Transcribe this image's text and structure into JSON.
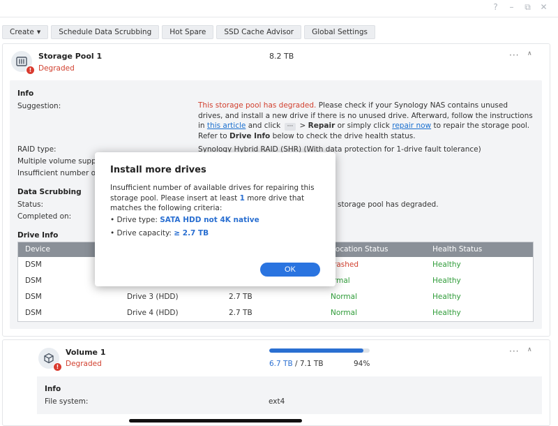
{
  "window_controls": {
    "help": "?",
    "minimize": "–",
    "restore": "⧉",
    "close": "✕"
  },
  "toolbar": {
    "create_label": "Create",
    "scrub_label": "Schedule Data Scrubbing",
    "hotspare_label": "Hot Spare",
    "ssd_label": "SSD Cache Advisor",
    "global_label": "Global Settings"
  },
  "pool": {
    "name": "Storage Pool 1",
    "status": "Degraded",
    "size": "8.2 TB",
    "info": {
      "title": "Info",
      "suggestion_label": "Suggestion:",
      "sugg_red": "This storage pool has degraded.",
      "sugg_1": " Please check if your Synology NAS contains unused drives, and install a new drive if there is no unused drive. Afterward, follow the instructions in ",
      "sugg_link1": "this article",
      "sugg_2": " and click ",
      "sugg_dots": "···",
      "sugg_3": " > ",
      "sugg_repair": "Repair",
      "sugg_4": " or simply click ",
      "sugg_link2": "repair now",
      "sugg_5": " to repair the storage pool. Refer to ",
      "sugg_driveinfo": "Drive Info",
      "sugg_6": " below to check the drive health status.",
      "raid_label": "RAID type:",
      "raid_value": "Synology Hybrid RAID (SHR) (With data protection for 1-drive fault tolerance)",
      "multi_label": "Multiple volume support",
      "insufficient_label": "Insufficient number of d"
    },
    "scrubbing": {
      "title": "Data Scrubbing",
      "status_label": "Status:",
      "status_value_partial": "storage pool has degraded.",
      "completed_label": "Completed on:"
    },
    "drive_info": {
      "title": "Drive Info",
      "headers": {
        "device": "Device",
        "allocation": "location Status",
        "health": "Health Status"
      },
      "rows": [
        {
          "device": "DSM",
          "drive": "",
          "size": "",
          "allocation": "rashed",
          "health": "Healthy"
        },
        {
          "device": "DSM",
          "drive": "",
          "size": "",
          "allocation": "rmal",
          "health": "Healthy"
        },
        {
          "device": "DSM",
          "drive": "Drive 3 (HDD)",
          "size": "2.7 TB",
          "allocation": "Normal",
          "health": "Healthy"
        },
        {
          "device": "DSM",
          "drive": "Drive 4 (HDD)",
          "size": "2.7 TB",
          "allocation": "Normal",
          "health": "Healthy"
        }
      ]
    }
  },
  "volume": {
    "name": "Volume 1",
    "status": "Degraded",
    "used": "6.7 TB",
    "separator": " / ",
    "total": "7.1 TB",
    "percent": "94%",
    "percent_value": 0.94,
    "info_title": "Info",
    "fs_label": "File system:",
    "fs_value": "ext4"
  },
  "modal": {
    "title": "Install more drives",
    "body_1": "Insufficient number of available drives for repairing this storage pool. Please insert at least ",
    "body_count": "1",
    "body_2": " more drive that matches the following criteria:",
    "type_label": "Drive type: ",
    "type_value": "SATA HDD not 4K native",
    "cap_label": "Drive capacity: ",
    "cap_value": "≥ 2.7 TB",
    "ok_label": "OK"
  },
  "colors": {
    "accent": "#2a74e0",
    "error": "#d1402f",
    "healthy": "#2e9b38"
  }
}
